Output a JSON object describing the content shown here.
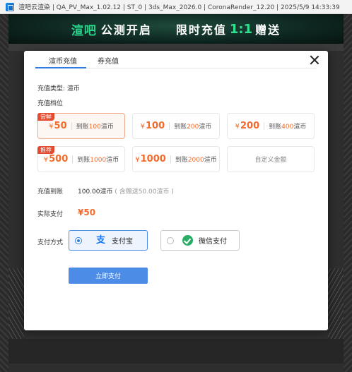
{
  "window": {
    "title": "渲吧云渲染 | QA_PV_Max_1.02.12 | ST_0 | 3ds_Max_2026.0 | CoronaRender_12.20 | 2025/5/9 14:33:39"
  },
  "banner": {
    "logo": "渲吧",
    "left_text": "公测开启",
    "right_text": "限时充值",
    "ratio": "1:1",
    "end_text": "赠送"
  },
  "tabs": [
    {
      "label": "渲币充值",
      "active": true
    },
    {
      "label": "券充值",
      "active": false
    }
  ],
  "recharge": {
    "type_label": "充值类型:",
    "type_value": "渲币",
    "level_label": "充值档位",
    "options": [
      {
        "badge": "尝鲜",
        "yen": "¥",
        "amount": "50",
        "recv_prefix": "到账",
        "recv_amount": "100",
        "recv_suffix": "渲币",
        "selected": true
      },
      {
        "badge": "",
        "yen": "¥",
        "amount": "100",
        "recv_prefix": "到账",
        "recv_amount": "200",
        "recv_suffix": "渲币",
        "selected": false
      },
      {
        "badge": "",
        "yen": "¥",
        "amount": "200",
        "recv_prefix": "到账",
        "recv_amount": "400",
        "recv_suffix": "渲币",
        "selected": false
      },
      {
        "badge": "推荐",
        "yen": "¥",
        "amount": "500",
        "recv_prefix": "到账",
        "recv_amount": "1000",
        "recv_suffix": "渲币",
        "selected": false
      },
      {
        "badge": "",
        "yen": "¥",
        "amount": "1000",
        "recv_prefix": "到账",
        "recv_amount": "2000",
        "recv_suffix": "渲币",
        "selected": false
      }
    ],
    "custom_label": "自定义金额",
    "arrive_label": "充值到账",
    "arrive_value": "100.00渲币",
    "arrive_note": "( 含赠送50.00渲币 )",
    "actual_label": "实际支付",
    "actual_value": "¥50",
    "method_label": "支付方式",
    "methods": [
      {
        "label": "支付宝",
        "icon": "alipay-icon",
        "selected": true
      },
      {
        "label": "微信支付",
        "icon": "wechat-pay-icon",
        "selected": false
      }
    ],
    "submit_label": "立即支付"
  },
  "colors": {
    "accent": "#2f7de1",
    "price": "#f26b2c",
    "badge": "#e64a2e",
    "button": "#4c8be6"
  }
}
